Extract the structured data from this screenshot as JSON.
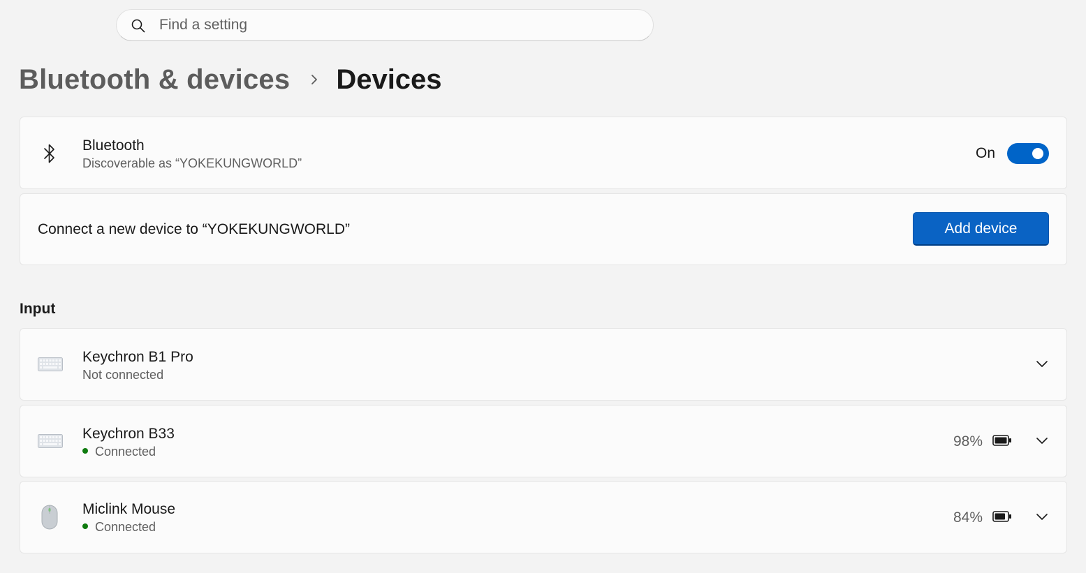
{
  "search": {
    "placeholder": "Find a setting"
  },
  "breadcrumb": {
    "parent": "Bluetooth & devices",
    "current": "Devices"
  },
  "bluetooth": {
    "title": "Bluetooth",
    "subtitle": "Discoverable as “YOKEKUNGWORLD”",
    "toggle_label": "On",
    "toggle_on": true,
    "icon": "bluetooth-icon"
  },
  "connect": {
    "text": "Connect a new device to “YOKEKUNGWORLD”",
    "button_label": "Add device"
  },
  "input_section": {
    "title": "Input",
    "devices": [
      {
        "name": "Keychron B1 Pro",
        "status": "Not connected",
        "connected": false,
        "battery": null,
        "icon": "keyboard-icon"
      },
      {
        "name": "Keychron B33",
        "status": "Connected",
        "connected": true,
        "battery": "98%",
        "icon": "keyboard-icon"
      },
      {
        "name": "Miclink Mouse",
        "status": "Connected",
        "connected": true,
        "battery": "84%",
        "icon": "mouse-icon"
      }
    ]
  },
  "colors": {
    "accent": "#0064c8",
    "connected_dot": "#0f7b0f",
    "background": "#f3f3f3",
    "card": "#fbfbfb"
  }
}
